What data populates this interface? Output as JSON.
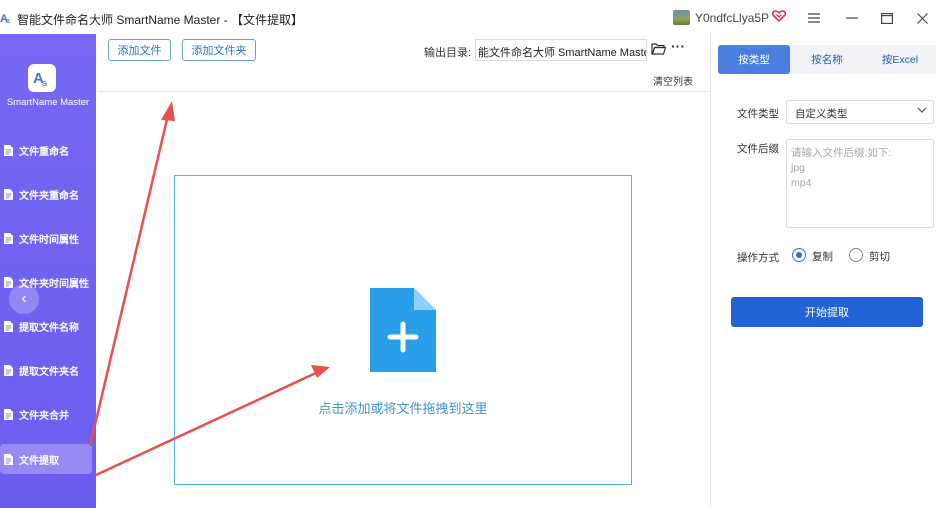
{
  "window": {
    "title": "智能文件命名大师 SmartName Master - 【文件提取】",
    "username": "Y0ndfcLlya5P",
    "menu_icon": "hamburger-icon",
    "minimize_icon": "minimize-icon",
    "maximize_icon": "maximize-icon",
    "close_icon": "close-icon"
  },
  "sidebar": {
    "brand": "SmartName Master",
    "items": [
      {
        "label": "文件重命名"
      },
      {
        "label": "文件夹重命名"
      },
      {
        "label": "文件时间属性"
      },
      {
        "label": "文件夹时间属性"
      },
      {
        "label": "提取文件名称"
      },
      {
        "label": "提取文件夹名"
      },
      {
        "label": "文件夹合并"
      },
      {
        "label": "文件提取",
        "active": true
      }
    ],
    "collapse_glyph": "‹"
  },
  "toolbar": {
    "add_file": "添加文件",
    "add_folder": "添加文件夹",
    "output_label": "输出目录:",
    "output_value": "能文件命名大师 SmartName Master",
    "more_glyph": "···",
    "clear_list": "清空列表"
  },
  "dropzone": {
    "text": "点击添加或将文件拖拽到这里"
  },
  "right_panel": {
    "tabs": [
      {
        "label": "按类型",
        "active": true
      },
      {
        "label": "按名称"
      },
      {
        "label": "按Excel"
      }
    ],
    "file_type_label": "文件类型",
    "file_type_value": "自定义类型",
    "suffix_label": "文件后缀",
    "suffix_placeholder": "请输入文件后缀,如下:\njpg\nmp4",
    "mode_label": "操作方式",
    "mode_copy": "复制",
    "mode_cut": "剪切",
    "mode_selected": "复制",
    "start_button": "开始提取"
  },
  "colors": {
    "sidebar": "#6a5ef0",
    "accent": "#1f63d6",
    "dropzone_border": "#57b2e5",
    "annotation_arrow": "#e8504a"
  }
}
